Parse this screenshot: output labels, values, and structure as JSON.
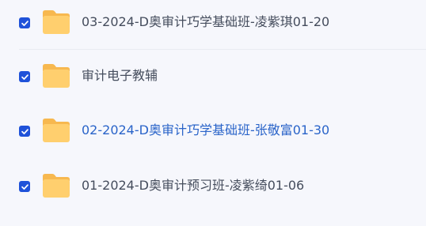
{
  "files": [
    {
      "name": "03-2024-D奥审计巧学基础班-凌紫琪01-20",
      "checked": true,
      "highlighted": false
    },
    {
      "name": "审计电子教辅",
      "checked": true,
      "highlighted": false
    },
    {
      "name": "02-2024-D奥审计巧学基础班-张敬富01-30",
      "checked": true,
      "highlighted": true
    },
    {
      "name": "01-2024-D奥审计预习班-凌紫绮01-06",
      "checked": true,
      "highlighted": false
    }
  ],
  "colors": {
    "background": "#f6f7fc",
    "checkbox": "#1f52d9",
    "folder": "#ffcf6e",
    "folder_tab": "#f7b84f",
    "text": "#454d5d",
    "highlight_text": "#2a64c9"
  },
  "icons": {
    "checkbox": "checkmark-icon",
    "folder": "folder-icon"
  }
}
